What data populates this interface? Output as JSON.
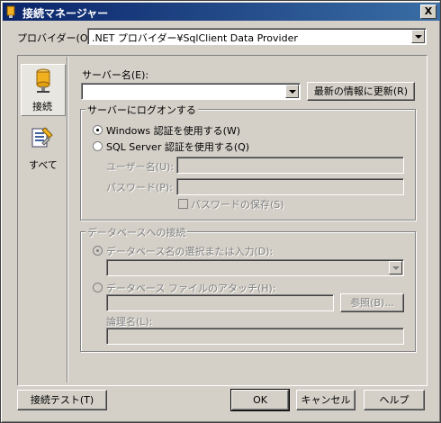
{
  "window": {
    "title": "接続マネージャー",
    "close_label": "X"
  },
  "provider": {
    "label": "プロバイダー(O):",
    "value": ".NET プロバイダー¥SqlClient Data Provider"
  },
  "sidebar": {
    "items": [
      {
        "label": "接続",
        "icon": "database-icon"
      },
      {
        "label": "すべて",
        "icon": "properties-icon"
      }
    ]
  },
  "server": {
    "label": "サーバー名(E):",
    "value": "",
    "refresh_label": "最新の情報に更新(R)"
  },
  "logon": {
    "title": "サーバーにログオンする",
    "windows_auth": "Windows 認証を使用する(W)",
    "sql_auth": "SQL Server 認証を使用する(Q)",
    "username_label": "ユーザー名(U):",
    "password_label": "パスワード(P):",
    "save_password": "パスワードの保存(S)",
    "selected": "windows"
  },
  "database": {
    "title": "データベースへの接続",
    "select_option": "データベース名の選択または入力(D):",
    "attach_option": "データベース ファイルのアタッチ(H):",
    "browse_label": "参照(B)...",
    "logical_name_label": "論理名(L):"
  },
  "footer": {
    "test_label": "接続テスト(T)",
    "ok_label": "OK",
    "cancel_label": "キャンセル",
    "help_label": "ヘルプ"
  }
}
